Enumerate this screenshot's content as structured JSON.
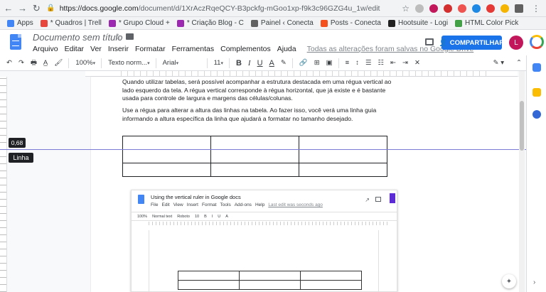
{
  "browser": {
    "url_host": "https://docs.google.com",
    "url_path": "/document/d/1XrAczRqeQCY-B3pckfg-mGoo1xp-f9k3c96GZG4u_1w/edit",
    "bookmarks": [
      {
        "label": "Apps",
        "color": "#4285f4"
      },
      {
        "label": "* Quadros | Trell",
        "color": "#e8453c"
      },
      {
        "label": "* Grupo Cloud +",
        "color": "#9c27b0"
      },
      {
        "label": "* Criação Blog - C",
        "color": "#9c27b0"
      },
      {
        "label": "Painel ‹ Conecta",
        "color": "#616161"
      },
      {
        "label": "Posts - Conecta",
        "color": "#f4511e"
      },
      {
        "label": "Hootsuite - Logi",
        "color": "#212121"
      },
      {
        "label": "HTML Color Pick",
        "color": "#43a047"
      }
    ]
  },
  "docs": {
    "title": "Documento sem título",
    "menus": [
      "Arquivo",
      "Editar",
      "Ver",
      "Inserir",
      "Formatar",
      "Ferramentas",
      "Complementos",
      "Ajuda"
    ],
    "saved_status": "Todas as alterações foram salvas no Google Drive",
    "share_label": "COMPARTILHAR",
    "avatar_letter": "L",
    "toolbar": {
      "zoom": "100%",
      "style": "Texto norm...",
      "font": "Arial",
      "size": "11",
      "bold": "B",
      "italic": "I",
      "underline": "U",
      "text_color": "A"
    }
  },
  "page": {
    "paragraph1": "Quando utilizar tabelas, será possível acompanhar a estrutura destacada em uma régua vertical ao lado esquerdo da tela. A régua vertical corresponde à régua horizontal, que já existe e é bastante usada para controle de largura e margens das células/colunas.",
    "paragraph2": "Use a régua para alterar a altura das linhas na tabela. Ao fazer isso, você verá uma linha guia informando a altura específica da linha que ajudará a formatar no tamanho desejado.",
    "table_rows": 3,
    "table_cols": 3
  },
  "ruler": {
    "value": "0,68",
    "label": "Linha"
  },
  "embedded": {
    "title": "Using the vertical ruler in Google docs",
    "menus": [
      "File",
      "Edit",
      "View",
      "Insert",
      "Format",
      "Tools",
      "Add-ons",
      "Help"
    ],
    "saved": "Last edit was seconds ago",
    "toolbar": [
      "100%",
      "Normal text",
      "Roboto",
      "10",
      "B",
      "I",
      "U",
      "A"
    ]
  }
}
